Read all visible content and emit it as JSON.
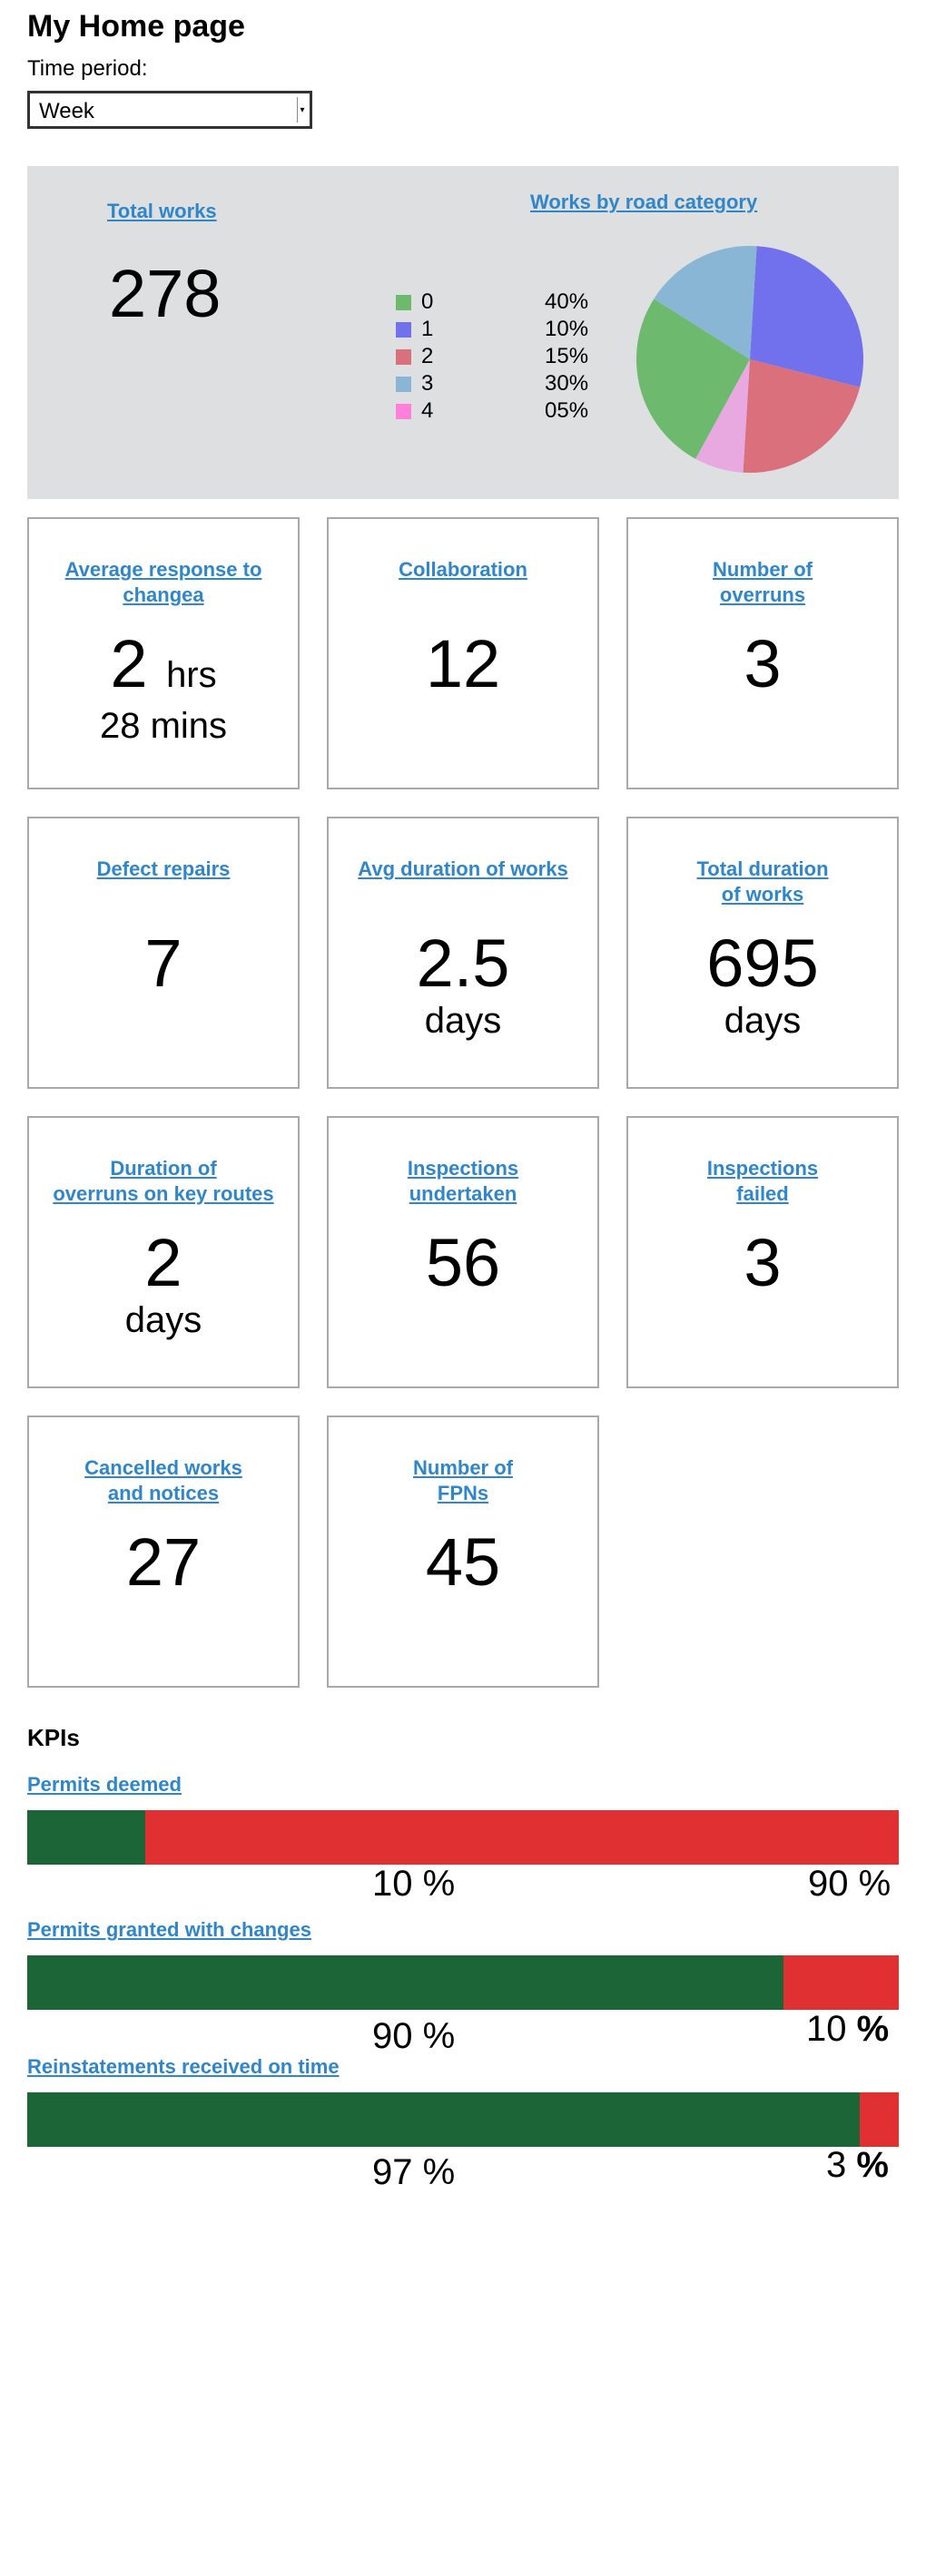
{
  "page": {
    "title": "My Home page"
  },
  "filter": {
    "label": "Time period:",
    "value": "Week"
  },
  "summary": {
    "total_title": "Total works",
    "total_value": "278",
    "category_title": "Works by road category",
    "categories": [
      {
        "label": "0",
        "pct_text": "40%",
        "value": 40,
        "color": "#6dba6f"
      },
      {
        "label": "1",
        "pct_text": "10%",
        "value": 10,
        "color": "#7171ee"
      },
      {
        "label": "2",
        "pct_text": "15%",
        "value": 15,
        "color": "#d9707c"
      },
      {
        "label": "3",
        "pct_text": "30%",
        "value": 30,
        "color": "#8ab6d6"
      },
      {
        "label": "4",
        "pct_text": "05%",
        "value": 5,
        "color": "#ff7fdb"
      }
    ],
    "pie_slices": [
      {
        "value": 28,
        "color": "#7171ee"
      },
      {
        "value": 22,
        "color": "#d9707c"
      },
      {
        "value": 7,
        "color": "#e8a8e0"
      },
      {
        "value": 26,
        "color": "#6dba6f"
      },
      {
        "value": 17,
        "color": "#8ab6d6"
      }
    ]
  },
  "cards": {
    "avg_response": {
      "title_line1": "Average response to",
      "title_line2": "changea",
      "value": "2",
      "unit": "hrs",
      "sub": "28 mins"
    },
    "collaboration": {
      "title": "Collaboration",
      "value": "12"
    },
    "overruns": {
      "title_line1": "Number of",
      "title_line2": "overruns",
      "value": "3"
    },
    "defect_repairs": {
      "title": "Defect repairs",
      "value": "7"
    },
    "avg_duration": {
      "title": "Avg duration of works",
      "value": "2.5",
      "unit": "days"
    },
    "total_duration": {
      "title_line1": "Total duration",
      "title_line2": "of works",
      "value": "695",
      "unit": "days"
    },
    "overrun_duration": {
      "title_line1": "Duration of",
      "title_line2": "overruns on key routes",
      "value": "2",
      "unit": "days"
    },
    "inspections_undertaken": {
      "title_line1": "Inspections",
      "title_line2": "undertaken",
      "value": "56"
    },
    "inspections_failed": {
      "title_line1": "Inspections",
      "title_line2": "failed",
      "value": "3"
    },
    "cancelled": {
      "title_line1": "Cancelled works",
      "title_line2": "and notices",
      "value": "27"
    },
    "fpns": {
      "title_line1": "Number of",
      "title_line2": "FPNs",
      "value": "45"
    }
  },
  "kpis": {
    "heading": "KPIs",
    "colors": {
      "good": "#1b6537",
      "bad": "#e03032"
    },
    "items": [
      {
        "title": "Permits deemed",
        "good_pct": 0.135,
        "left_label": "10 %",
        "right_num": "90",
        "right_sym": "%"
      },
      {
        "title": "Permits granted with changes",
        "good_pct": 0.868,
        "left_label": "90 %",
        "right_num": "10",
        "right_sym": "%"
      },
      {
        "title": "Reinstatements received on time",
        "good_pct": 0.955,
        "left_label": "97 %",
        "right_num": "3",
        "right_sym": "%"
      }
    ]
  }
}
